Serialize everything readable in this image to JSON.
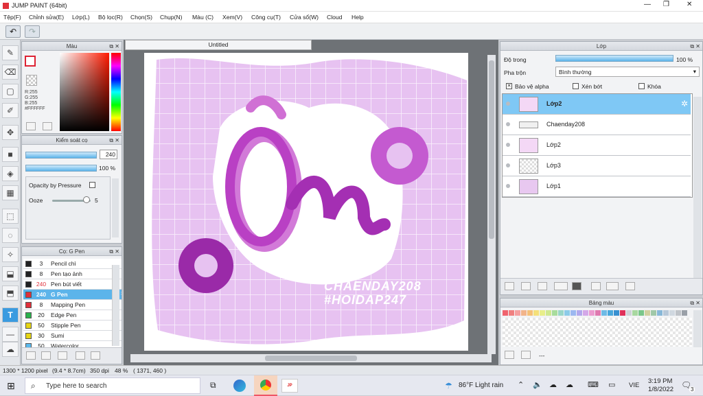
{
  "window": {
    "title": "JUMP PAINT (64bit)"
  },
  "menu": [
    "Tệp(F)",
    "Chỉnh sửa(E)",
    "Lớp(L)",
    "Bộ lọc(R)",
    "Chọn(S)",
    "Chụp(N)",
    "Màu (C)",
    "Xem(V)",
    "Công cụ(T)",
    "Cửa sổ(W)",
    "Cloud",
    "Help"
  ],
  "color_panel": {
    "title": "Màu",
    "r": "R:255",
    "g": "G:255",
    "b": "B:255",
    "hex": "#FFFFFF"
  },
  "brush_ctrl": {
    "title": "Kiểm soát cọ",
    "size": "240",
    "opacity": "100 %",
    "pressure_label": "Opacity by Pressure",
    "ooze_label": "Ooze",
    "ooze_value": "5",
    "ooze_level": 0.9
  },
  "brush_list": {
    "title": "Cọ: G Pen",
    "items": [
      {
        "size": "3",
        "name": "Pencil chì",
        "color": "#222222"
      },
      {
        "size": "8",
        "name": "Pen tạo ảnh",
        "color": "#222222"
      },
      {
        "size": "240",
        "name": "Pen bút viết",
        "color": "#222222"
      },
      {
        "size": "240",
        "name": "G Pen",
        "color": "#e0303a"
      },
      {
        "size": "8",
        "name": "Mapping Pen",
        "color": "#e0303a"
      },
      {
        "size": "20",
        "name": "Edge Pen",
        "color": "#2bb24c"
      },
      {
        "size": "50",
        "name": "Stipple Pen",
        "color": "#e5d514"
      },
      {
        "size": "30",
        "name": "Sumi",
        "color": "#e5d514"
      },
      {
        "size": "50",
        "name": "Watercolor",
        "color": "#5bb9ec"
      }
    ]
  },
  "canvas": {
    "tab": "Untitled",
    "watermark1": "CHAENDAY208",
    "watermark2": "#HOIDAP247",
    "art_text": "Ồn"
  },
  "layer_panel": {
    "title": "Lớp",
    "opacity_label": "Độ trong",
    "opacity_value": "100 %",
    "opacity_level": 1,
    "blend_label": "Pha trộn",
    "blend_value": "Bình thường",
    "protect_alpha": "Bảo vệ alpha",
    "clip": "Xén bớt",
    "lock": "Khóa",
    "layers": [
      {
        "name": "Lớp2",
        "selected": true
      },
      {
        "name": "Chaenday208",
        "selected": false
      },
      {
        "name": "Lớp2",
        "selected": false
      },
      {
        "name": "Lớp3",
        "selected": false
      },
      {
        "name": "Lớp1",
        "selected": false
      }
    ]
  },
  "palette": {
    "title": "Bảng màu",
    "dash": "---",
    "colors": [
      "#f0646e",
      "#f08080",
      "#f5a0a0",
      "#f2b48a",
      "#f5c078",
      "#f5e07a",
      "#e8ee8a",
      "#cfe890",
      "#a8dc9c",
      "#9ad6c8",
      "#8ccbe8",
      "#9cb8f0",
      "#b2a8ec",
      "#d4a8e8",
      "#ec9cd0",
      "#e07ab0",
      "#6fbbe6",
      "#4aa8dc",
      "#3890d0",
      "#e0305a",
      "#cfd2d8",
      "#a8d8a0",
      "#7ac68a",
      "#d0d0a0",
      "#a0c8a8",
      "#88b8d8",
      "#b8c8d8",
      "#d0d8e0",
      "#bfc3c8",
      "#9aa0a8"
    ]
  },
  "status": {
    "size": "1300 * 1200 pixel",
    "cm": "(9.4 * 8.7cm)",
    "dpi": "350 dpi",
    "zoom": "48 %",
    "coord": "( 1371, 460 )"
  },
  "taskbar": {
    "search": "Type here to search",
    "weather": "86°F  Light rain",
    "lang": "VIE",
    "time": "3:19 PM",
    "date": "1/8/2022",
    "notif": "3"
  },
  "colors": {
    "accent": "#5cb4ea",
    "selected_layer": "#7fc8f5",
    "canvas_bg": "#e7c2f1"
  }
}
